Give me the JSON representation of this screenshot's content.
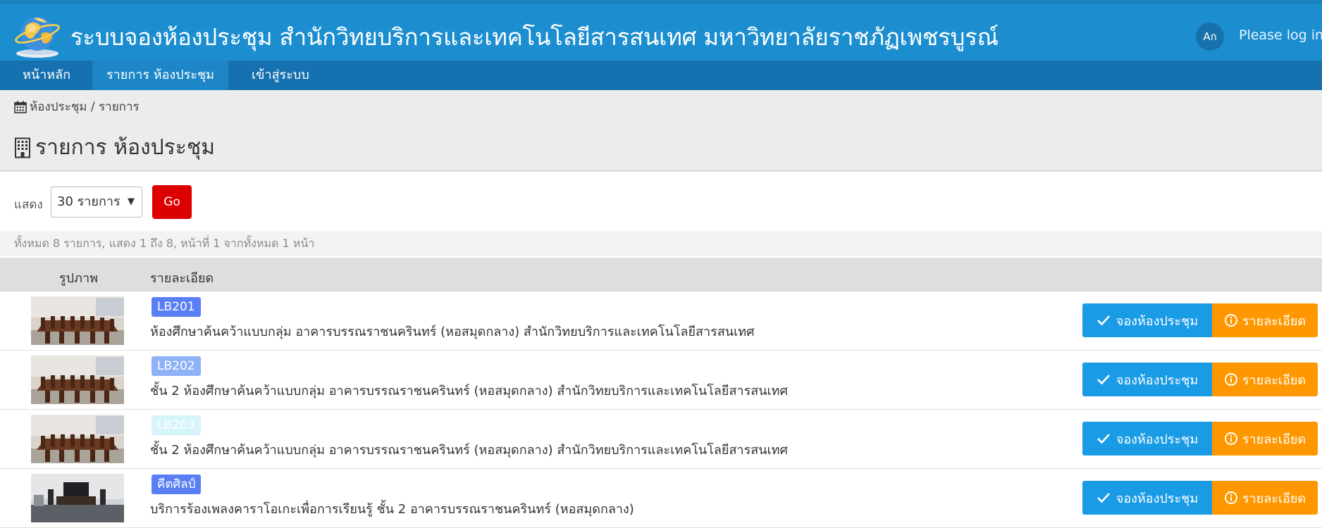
{
  "header": {
    "title": "ระบบจองห้องประชุม สำนักวิทยบริการและเทคโนโลยีสารสนเทศ มหาวิทยาลัยราชภัฏเพชรบูรณ์",
    "lang_label": "Aก",
    "login_label": "Please log in"
  },
  "nav": [
    {
      "label": "หน้าหลัก"
    },
    {
      "label": "รายการ ห้องประชุม"
    },
    {
      "label": "เข้าสู่ระบบ"
    }
  ],
  "breadcrumb": "ห้องประชุม / รายการ",
  "page_title": "รายการ ห้องประชุม",
  "filter": {
    "label": "แสดง",
    "per_page_value": "30 รายการ",
    "go_label": "Go"
  },
  "summary": "ทั้งหมด 8 รายการ, แสดง 1 ถึง 8, หน้าที่ 1 จากทั้งหมด 1 หน้า",
  "table": {
    "col_image": "รูปภาพ",
    "col_detail": "รายละเอียด",
    "book_label": "จองห้องประชุม",
    "detail_label": "รายละเอียด",
    "rows": [
      {
        "code": "LB201",
        "badge_color": "#5a7ff5",
        "description": "ห้องศึกษาค้นคว้าแบบกลุ่ม อาคารบรรณราชนครินทร์ (หอสมุดกลาง) สำนักวิทยบริการและเทคโนโลยีสารสนเทศ"
      },
      {
        "code": "LB202",
        "badge_color": "#8fb2f7",
        "description": "ชั้น 2 ห้องศึกษาค้นคว้าแบบกลุ่ม อาคารบรรณราชนครินทร์ (หอสมุดกลาง) สำนักวิทยบริการและเทคโนโลยีสารสนเทศ"
      },
      {
        "code": "LB203",
        "badge_color": "#d6f4fb",
        "description": "ชั้น 2 ห้องศึกษาค้นคว้าแบบกลุ่ม อาคารบรรณราชนครินทร์ (หอสมุดกลาง) สำนักวิทยบริการและเทคโนโลยีสารสนเทศ"
      },
      {
        "code": "คีตศิลป์",
        "badge_color": "#5a7ff5",
        "description": "บริการร้องเพลงคาราโอเกะเพื่อการเรียนรู้ ชั้น 2 อาคารบรรณราชนครินทร์ (หอสมุดกลาง)"
      }
    ]
  }
}
